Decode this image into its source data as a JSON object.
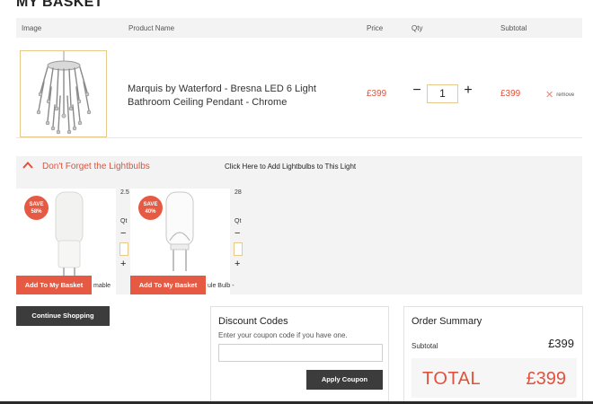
{
  "page": {
    "title": "MY BASKET"
  },
  "table": {
    "headers": {
      "image": "Image",
      "product_name": "Product Name",
      "price": "Price",
      "qty": "Qty",
      "subtotal": "Subtotal"
    }
  },
  "item": {
    "name": "Marquis by Waterford - Bresna LED 6 Light Bathroom Ceiling Pendant - Chrome",
    "price": "£399",
    "qty": "1",
    "subtotal": "£399",
    "remove_label": "remove",
    "minus_symbol": "−",
    "plus_symbol": "+"
  },
  "lightbulbs": {
    "title": "Don't Forget the Lightbulbs",
    "link": "Click Here to Add Lightbulbs to This Light",
    "products": [
      {
        "badge_line1": "SAVE",
        "badge_line2": "58%",
        "button": "Add To My Basket",
        "price_partial": "2.5",
        "qty_partial": "Qt",
        "name_partial": "mable"
      },
      {
        "badge_line1": "SAVE",
        "badge_line2": "40%",
        "button": "Add To My Basket",
        "price_partial": "28",
        "qty_partial": "Qt",
        "name_partial": "ule Bulb -"
      }
    ]
  },
  "actions": {
    "continue": "Continue Shopping"
  },
  "discount": {
    "title": "Discount Codes",
    "subtitle": "Enter your coupon code if you have one.",
    "input_value": "",
    "button": "Apply Coupon"
  },
  "summary": {
    "title": "Order Summary",
    "subtotal_label": "Subtotal",
    "subtotal_value": "£399",
    "total_label": "TOTAL",
    "total_value": "£399"
  },
  "colors": {
    "accent": "#e0523b",
    "dark_button": "#3c3c3c",
    "panel": "#f3f3f3",
    "input_border": "#e8c98c"
  }
}
